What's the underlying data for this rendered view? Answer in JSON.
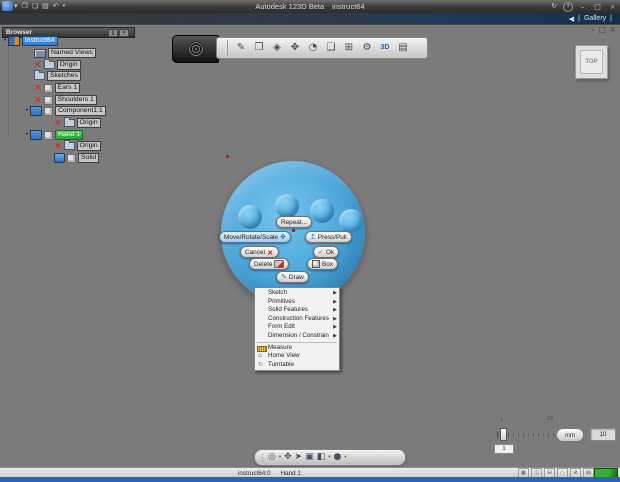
{
  "titlebar": {
    "app_name": "Autodesk 123D Beta",
    "doc_name": "instruct64",
    "quick_icons": [
      {
        "name": "app-menu-caret",
        "glyph": "▾"
      },
      {
        "name": "new-document",
        "glyph": "❐"
      },
      {
        "name": "open-document",
        "glyph": "❏"
      },
      {
        "name": "save-document",
        "glyph": "▤"
      },
      {
        "name": "undo",
        "glyph": "↶"
      },
      {
        "name": "more-caret",
        "glyph": "▾"
      }
    ],
    "right_icons": [
      {
        "name": "sync",
        "glyph": "↻"
      },
      {
        "name": "help",
        "glyph": "?"
      }
    ],
    "window_buttons": {
      "minimize": "–",
      "maximize": "□",
      "close": "×"
    }
  },
  "tab_bar": {
    "back_arrow": "◀",
    "separator": "|",
    "gallery_label": "Gallery"
  },
  "doc_window_buttons": {
    "minimize": "–",
    "restore": "□",
    "close": "×"
  },
  "browser": {
    "title": "Browser",
    "header_buttons": {
      "float": "▯",
      "close": "×"
    },
    "bullet": "•",
    "hidden_glyph": "×",
    "tree": [
      {
        "label": "instruct64"
      },
      {
        "label": "Named Views"
      },
      {
        "label": "Origin"
      },
      {
        "label": "Sketches"
      },
      {
        "label": "Ears 1"
      },
      {
        "label": "Shoulders 1"
      },
      {
        "label": "Component1:1"
      },
      {
        "label": "Origin"
      },
      {
        "label": "Hand 1"
      },
      {
        "label": "Origin"
      },
      {
        "label": "Solid"
      }
    ]
  },
  "toolbar": {
    "icons": [
      {
        "name": "sketch",
        "glyph": "✎"
      },
      {
        "name": "primitives",
        "glyph": "❒"
      },
      {
        "name": "sculpt",
        "glyph": "◈"
      },
      {
        "name": "move",
        "glyph": "✥"
      },
      {
        "name": "view",
        "glyph": "◔"
      },
      {
        "name": "combine",
        "glyph": "❏"
      },
      {
        "name": "pattern",
        "glyph": "⊞"
      },
      {
        "name": "gears",
        "glyph": "⚙"
      },
      {
        "name": "export-3d",
        "glyph": "3D"
      },
      {
        "name": "snapshot",
        "glyph": "▤"
      }
    ]
  },
  "view_cube": {
    "face": "TOP"
  },
  "scene": {
    "cursor_glyph": "➤"
  },
  "marking_menu": {
    "repeat": "Repeat...",
    "move_rotate_scale": "Move/Rotate/Scale",
    "press_pull": "Press/Pull",
    "cancel": "Cancel",
    "ok": "Ok",
    "delete": "Delete",
    "box": "Box",
    "draw": "Draw",
    "cancel_glyph": "×",
    "ok_glyph": "✓",
    "draw_glyph": "✎",
    "move_glyph": "✥",
    "press_glyph": "↥"
  },
  "context_menu": {
    "submenu_arrow": "▶",
    "items": [
      {
        "label": "Sketch",
        "submenu": true
      },
      {
        "label": "Primitives",
        "submenu": true
      },
      {
        "label": "Solid Features",
        "submenu": true
      },
      {
        "label": "Construction Features",
        "submenu": true
      },
      {
        "label": "Form Edit",
        "submenu": true
      },
      {
        "label": "Dimension / Constrain",
        "submenu": true
      },
      {
        "label": "Measure",
        "submenu": false
      },
      {
        "label": "Home View",
        "submenu": false
      },
      {
        "label": "Turntable",
        "submenu": false
      }
    ],
    "home_glyph": "⌂",
    "turntable_glyph": "↻"
  },
  "nav_bar": {
    "caret": "▾",
    "icons": [
      {
        "name": "orbit",
        "glyph": "◎"
      },
      {
        "name": "pan",
        "glyph": "✥"
      },
      {
        "name": "select",
        "glyph": "➤"
      },
      {
        "name": "fit",
        "glyph": "▣"
      },
      {
        "name": "view-cube",
        "glyph": "◧"
      },
      {
        "name": "display-style",
        "glyph": "●"
      }
    ]
  },
  "snap_slider": {
    "min_label": "1",
    "max_label": "10",
    "value": "1",
    "unit": "mm",
    "grid_size": "10"
  },
  "status_bar": {
    "document": "instruct64:0",
    "selection": "Hand 1",
    "icons": [
      {
        "name": "grid-toggle",
        "glyph": "▦"
      },
      {
        "name": "snap-toggle",
        "glyph": "◫"
      },
      {
        "name": "ortho-toggle",
        "glyph": "⊟"
      },
      {
        "name": "loop-toggle",
        "glyph": "◌"
      },
      {
        "name": "record-disabled",
        "glyph": "⊘"
      },
      {
        "name": "screen-toggle",
        "glyph": "▤"
      }
    ]
  },
  "colors": {
    "accent_blue": "#2f78cc",
    "accent_green": "#2ba03a",
    "model_blue": "#4aa6dc",
    "taskbar_blue": "#2e62b8"
  }
}
